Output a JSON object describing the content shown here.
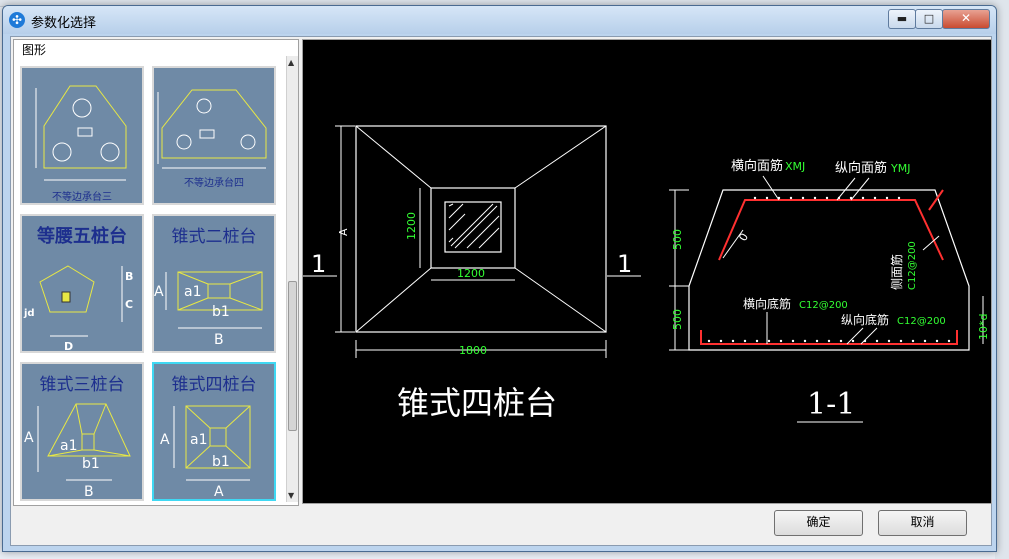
{
  "dialog": {
    "title": "参数化选择"
  },
  "window_buttons": {
    "minimize": "▬",
    "maximize": "□",
    "close": "✕"
  },
  "left_panel": {
    "group_label": "图形",
    "thumbnails": [
      {
        "title": "",
        "caption": "不等边承台三",
        "selected": false
      },
      {
        "title": "",
        "caption": "不等边承台四",
        "selected": false
      },
      {
        "title": "等腰五桩台",
        "labels": [
          "B",
          "C",
          "D",
          "jd"
        ],
        "selected": false
      },
      {
        "title": "锥式二桩台",
        "labels": [
          "A",
          "a1",
          "b1",
          "B"
        ],
        "selected": false
      },
      {
        "title": "锥式三桩台",
        "labels": [
          "A",
          "a1",
          "b1",
          "B"
        ],
        "selected": false
      },
      {
        "title": "锥式四桩台",
        "labels": [
          "A",
          "a1",
          "b1",
          "A"
        ],
        "selected": true
      }
    ]
  },
  "preview": {
    "plan_title": "锥式四桩台",
    "section_title": "1-1",
    "section_mark": "1",
    "dim_inner_v": "1200",
    "dim_inner_h": "1200",
    "dim_outer_h": "1800",
    "dim_outer_v": "A",
    "sec_dim_top": "500",
    "sec_dim_bottom": "500",
    "sec_dim_right": "10*d",
    "sec_dim_slope": "0",
    "label_top_transverse": "横向面筋",
    "label_top_transverse_code": "XMJ",
    "label_top_longitudinal": "纵向面筋",
    "label_top_longitudinal_code": "YMJ",
    "label_side": "侧面筋",
    "label_side_code": "C12@200",
    "label_bottom_transverse": "横向底筋",
    "label_bottom_transverse_code": "C12@200",
    "label_bottom_longitudinal": "纵向底筋",
    "label_bottom_longitudinal_code": "C12@200"
  },
  "buttons": {
    "ok": "确定",
    "cancel": "取消"
  },
  "colors": {
    "cad_line": "#ffffff",
    "cad_text_green": "#33ff33",
    "rebar_red": "#ff3030",
    "thumb_bg": "#6f8aa6",
    "thumb_line": "#e8e844",
    "selected_border": "#3fd8f3"
  }
}
